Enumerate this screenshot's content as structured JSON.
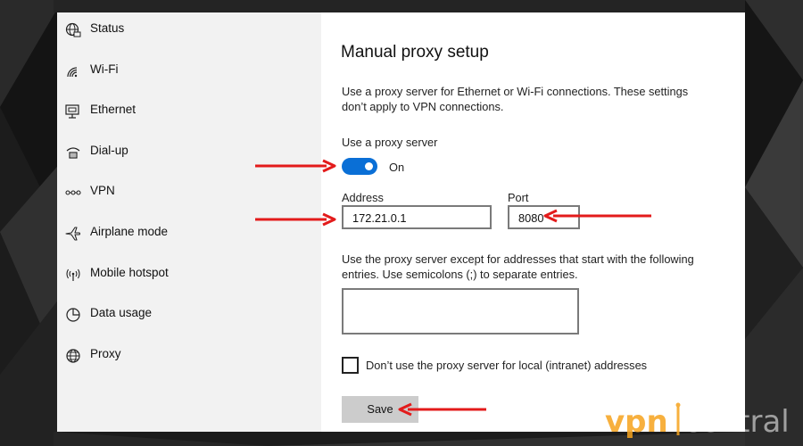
{
  "sidebar": {
    "items": [
      {
        "label": "Status",
        "icon": "globe-status-icon"
      },
      {
        "label": "Wi-Fi",
        "icon": "wifi-icon"
      },
      {
        "label": "Ethernet",
        "icon": "ethernet-icon"
      },
      {
        "label": "Dial-up",
        "icon": "dial-up-icon"
      },
      {
        "label": "VPN",
        "icon": "vpn-icon"
      },
      {
        "label": "Airplane mode",
        "icon": "airplane-icon"
      },
      {
        "label": "Mobile hotspot",
        "icon": "hotspot-icon"
      },
      {
        "label": "Data usage",
        "icon": "data-usage-icon"
      },
      {
        "label": "Proxy",
        "icon": "globe-icon"
      }
    ]
  },
  "main": {
    "title": "Manual proxy setup",
    "description": "Use a proxy server for Ethernet or Wi-Fi connections. These settings don’t apply to VPN connections.",
    "use_proxy_label": "Use a proxy server",
    "toggle_state": "On",
    "address_label": "Address",
    "address_value": "172.21.0.1",
    "port_label": "Port",
    "port_value": "8080",
    "exceptions_description": "Use the proxy server except for addresses that start with the following entries. Use semicolons (;) to separate entries.",
    "exceptions_value": "",
    "local_checkbox_label": "Don’t use the proxy server for local (intranet) addresses",
    "local_checkbox_checked": false,
    "save_label": "Save"
  },
  "watermark": {
    "text_left": "vpn",
    "text_right": "central"
  },
  "colors": {
    "accent": "#0a6fd6",
    "arrow": "#e31b1b",
    "watermark_orange": "#f6a21c"
  }
}
